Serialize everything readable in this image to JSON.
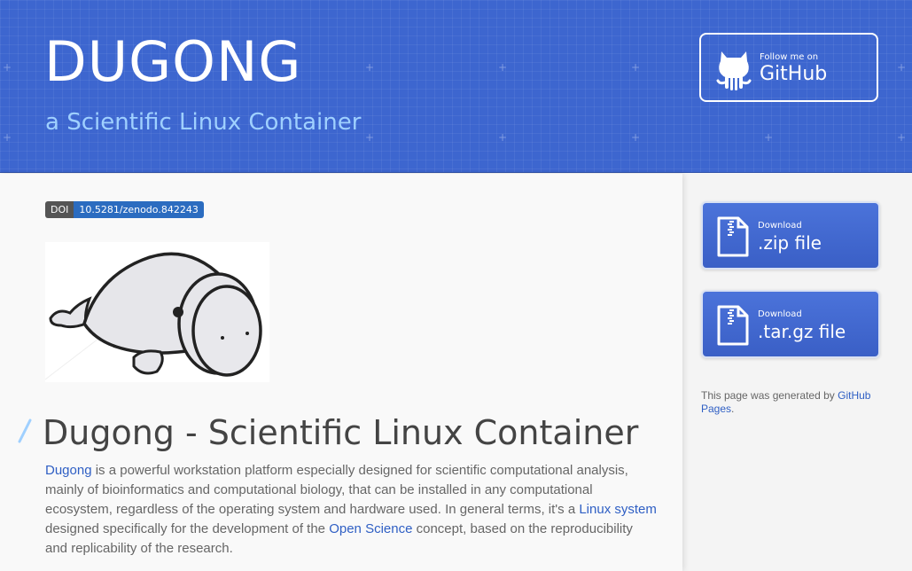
{
  "header": {
    "title": "DUGONG",
    "subtitle": "a Scientific Linux Container",
    "github_button": {
      "small_label": "Follow me on",
      "big_label": "GitHub",
      "icon": "octocat-icon"
    }
  },
  "badge": {
    "left": "DOI",
    "right": "10.5281/zenodo.842243"
  },
  "main": {
    "logo_icon": "dugong-logo",
    "heading": "Dugong - Scientific Linux Container",
    "intro": {
      "link1": "Dugong",
      "text1": " is a powerful workstation platform especially designed for scientific computational analysis, mainly of bioinformatics and computational biology, that can be installed in any computational ecosystem, regardless of the operating system and hardware used. In general terms, it's a ",
      "link2": "Linux system",
      "text2": " designed specifically for the development of the ",
      "link3": "Open Science",
      "text3": " concept, based on the reproducibility and replicability of the research."
    }
  },
  "sidebar": {
    "zip": {
      "small_label": "Download",
      "big_label": ".zip file",
      "icon": "zip-file-icon"
    },
    "tar": {
      "small_label": "Download",
      "big_label": ".tar.gz file",
      "icon": "zip-file-icon"
    },
    "generated_text": "This page was generated by ",
    "generated_link": "GitHub Pages",
    "generated_end": "."
  },
  "colors": {
    "header_bg": "#3d66cf",
    "subtitle": "#9fd0ff",
    "link": "#2f5fc4",
    "button_bg": "#4b73da"
  }
}
